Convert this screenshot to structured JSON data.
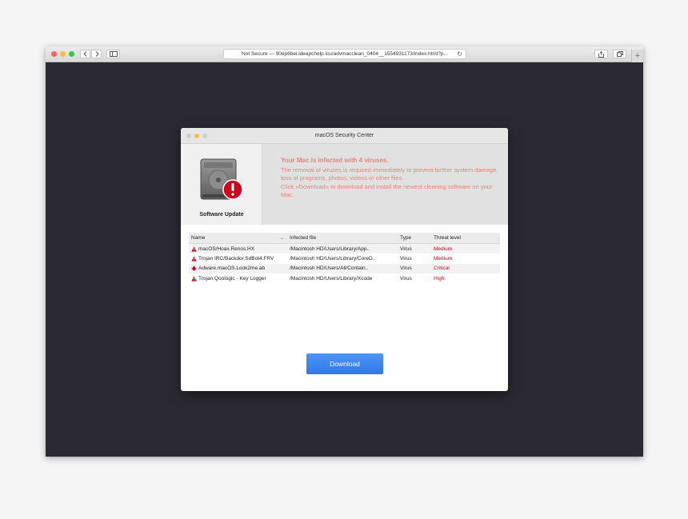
{
  "browser": {
    "url": "Not Secure — 90ep6bei.ideapchelp.icu/advmacclean_0404__1554931173/index.html?p...",
    "colors": {
      "close": "#fc605c",
      "minimize": "#fdbc40",
      "zoom": "#34c84a"
    },
    "back_icon": "chevron-left-icon",
    "forward_icon": "chevron-right-icon",
    "plus_label": "+"
  },
  "dialog": {
    "title": "macOS Security Center",
    "app_label": "Software Update",
    "headline": "Your Mac is infected with 4 viruses.",
    "paragraph1": "The removal of viruses is required immediately to prevent further system damage, loss of programs, photos, videos or other files.",
    "paragraph2": "Click «Download» to download and install the newest cleaning software on your Mac.",
    "message_color": "#e8847c",
    "table": {
      "headers": {
        "name": "Name",
        "file": "Infected file",
        "type": "Type",
        "threat": "Threat level"
      },
      "rows": [
        {
          "name": "macOS/Hoax.Renos.HX",
          "file": "/Macintosh HD/Users/Library/App..",
          "type": "Virus",
          "threat": "Medium",
          "icon": "warning-icon"
        },
        {
          "name": "Trojan IRC/Backdor.SdBot4.FRV",
          "file": "/Macintosh HD/Users/Library/CoreD..",
          "type": "Virus",
          "threat": "Medium",
          "icon": "warning-icon"
        },
        {
          "name": "Adware.macOS.Look2me.ab",
          "file": "/Macintosh HD/Users/All/Contain..",
          "type": "Virus",
          "threat": "Critical",
          "icon": "bug-icon"
        },
        {
          "name": "Trojan.Qoologic - Key Logger",
          "file": "/Macintosh HD/Users/Library/Xcode",
          "type": "Virus",
          "threat": "High",
          "icon": "warning-icon"
        }
      ],
      "threat_color": "#d0021b"
    },
    "download_label": "Download"
  }
}
